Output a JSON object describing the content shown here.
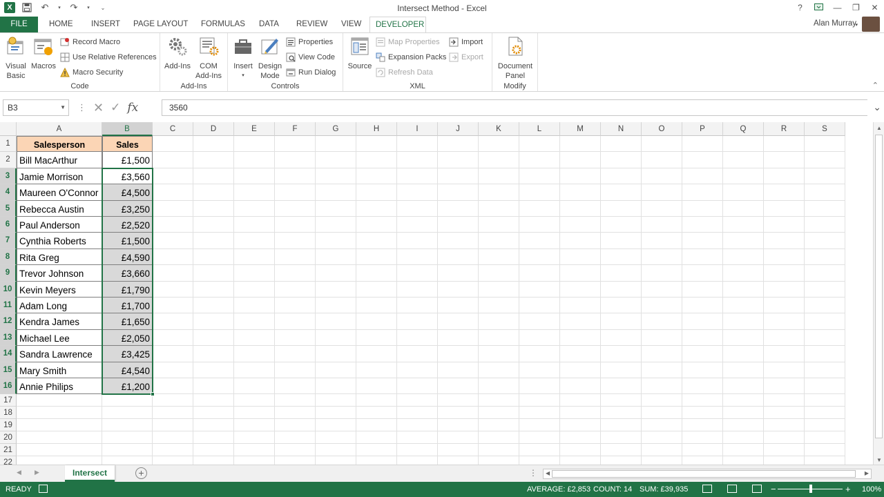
{
  "window": {
    "title": "Intersect Method - Excel",
    "help": "?",
    "user_name": "Alan Murray"
  },
  "tabs": [
    "FILE",
    "HOME",
    "INSERT",
    "PAGE LAYOUT",
    "FORMULAS",
    "DATA",
    "REVIEW",
    "VIEW",
    "DEVELOPER"
  ],
  "active_tab": "DEVELOPER",
  "ribbon": {
    "code": {
      "label": "Code",
      "visual_basic": [
        "Visual",
        "Basic"
      ],
      "macros": "Macros",
      "record_macro": "Record Macro",
      "relative_refs": "Use Relative References",
      "macro_security": "Macro Security"
    },
    "addins": {
      "label": "Add-Ins",
      "addins": "Add-Ins",
      "com_addins": [
        "COM",
        "Add-Ins"
      ]
    },
    "controls": {
      "label": "Controls",
      "insert": "Insert",
      "design_mode": [
        "Design",
        "Mode"
      ],
      "properties": "Properties",
      "view_code": "View Code",
      "run_dialog": "Run Dialog"
    },
    "xml": {
      "label": "XML",
      "source": "Source",
      "map_properties": "Map Properties",
      "expansion_packs": "Expansion Packs",
      "refresh_data": "Refresh Data",
      "import": "Import",
      "export": "Export"
    },
    "modify": {
      "label": "Modify",
      "document_panel": [
        "Document",
        "Panel"
      ]
    }
  },
  "formula_bar": {
    "name_box": "B3",
    "formula": "3560"
  },
  "grid": {
    "columns": [
      "A",
      "B",
      "C",
      "D",
      "E",
      "F",
      "G",
      "H",
      "I",
      "J",
      "K",
      "L",
      "M",
      "N",
      "O",
      "P",
      "Q",
      "R",
      "S"
    ],
    "rows": [
      "1",
      "2",
      "3",
      "4",
      "5",
      "6",
      "7",
      "8",
      "9",
      "10",
      "11",
      "12",
      "13",
      "14",
      "15",
      "16",
      "17",
      "18",
      "19",
      "20",
      "21",
      "22"
    ],
    "headers": [
      "Salesperson",
      "Sales"
    ],
    "data": [
      [
        "Bill MacArthur",
        "£1,500"
      ],
      [
        "Jamie Morrison",
        "£3,560"
      ],
      [
        "Maureen O'Connor",
        "£4,500"
      ],
      [
        "Rebecca Austin",
        "£3,250"
      ],
      [
        "Paul Anderson",
        "£2,520"
      ],
      [
        "Cynthia Roberts",
        "£1,500"
      ],
      [
        "Rita Greg",
        "£4,590"
      ],
      [
        "Trevor Johnson",
        "£3,660"
      ],
      [
        "Kevin Meyers",
        "£1,790"
      ],
      [
        "Adam Long",
        "£1,700"
      ],
      [
        "Kendra James",
        "£1,650"
      ],
      [
        "Michael Lee",
        "£2,050"
      ],
      [
        "Sandra Lawrence",
        "£3,425"
      ],
      [
        "Mary Smith",
        "£4,540"
      ],
      [
        "Annie Philips",
        "£1,200"
      ]
    ],
    "selected_column": "B",
    "selected_range": "B3:B16",
    "active_cell": "B3"
  },
  "sheets": [
    "Intersect"
  ],
  "status": {
    "mode": "READY",
    "average": "AVERAGE: £2,853",
    "count": "COUNT: 14",
    "sum": "SUM: £39,935",
    "zoom": "100%"
  },
  "colors": {
    "accent": "#217346",
    "header_fill": "#fbd5b5",
    "selection_fill": "#d9d9d9"
  }
}
